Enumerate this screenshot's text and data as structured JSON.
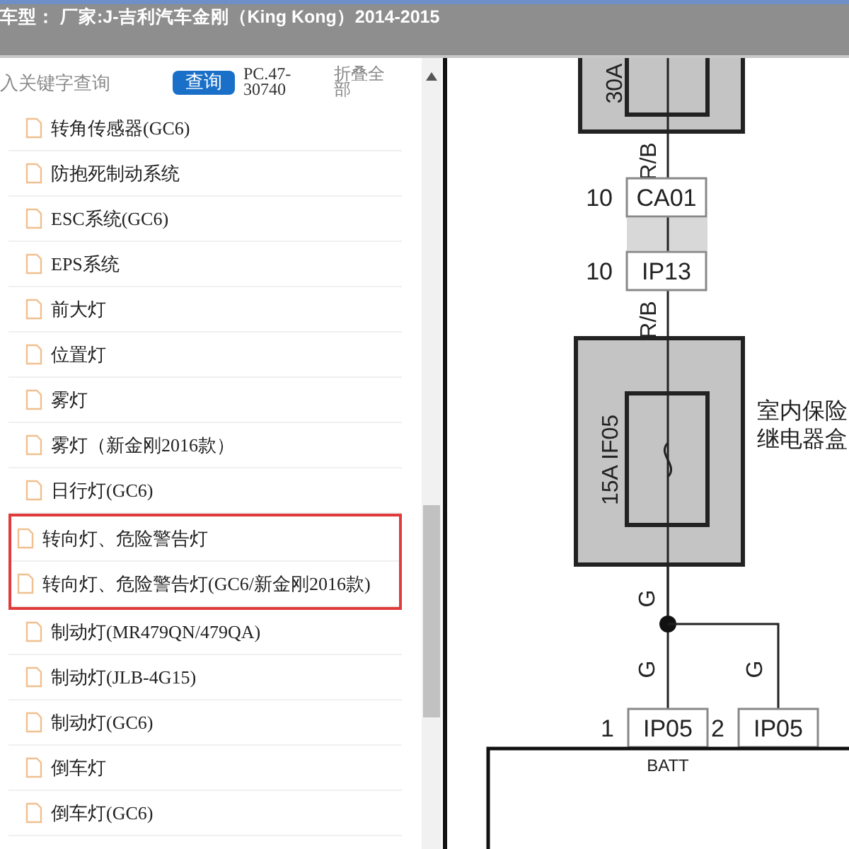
{
  "title_bar": {
    "title": "车型： 厂家:J-吉利汽车金刚（King Kong）2014-2015"
  },
  "toolbar": {
    "placeholder": "入关键字查询",
    "search_button": "查询",
    "code": "PC.47-30740",
    "collapse": "折叠全部"
  },
  "tree": {
    "items": [
      {
        "label": "转角传感器(GC6)",
        "selected": false
      },
      {
        "label": "防抱死制动系统",
        "selected": false
      },
      {
        "label": "ESC系统(GC6)",
        "selected": false
      },
      {
        "label": "EPS系统",
        "selected": false
      },
      {
        "label": "前大灯",
        "selected": false
      },
      {
        "label": "位置灯",
        "selected": false
      },
      {
        "label": "雾灯",
        "selected": false
      },
      {
        "label": "雾灯（新金刚2016款）",
        "selected": false
      },
      {
        "label": "日行灯(GC6)",
        "selected": false
      },
      {
        "label": "转向灯、危险警告灯",
        "selected": true
      },
      {
        "label": "转向灯、危险警告灯(GC6/新金刚2016款)",
        "selected": true
      },
      {
        "label": "制动灯(MR479QN/479QA)",
        "selected": false
      },
      {
        "label": "制动灯(JLB-4G15)",
        "selected": false
      },
      {
        "label": "制动灯(GC6)",
        "selected": false
      },
      {
        "label": "倒车灯",
        "selected": false
      },
      {
        "label": "倒车灯(GC6)",
        "selected": false
      }
    ]
  },
  "diagram": {
    "top_fuse": "30A",
    "wire_labels": [
      "R/B",
      "R/B",
      "G",
      "G",
      "G"
    ],
    "connectors": [
      {
        "pin": "10",
        "name": "CA01"
      },
      {
        "pin": "10",
        "name": "IP13"
      }
    ],
    "fuse": "15A IF05",
    "box_label": [
      "室内保险",
      "继电器盒"
    ],
    "bottom_connectors": [
      {
        "pin": "1",
        "name": "IP05"
      },
      {
        "pin": "2",
        "name": "IP05"
      }
    ],
    "bottom_label": "BATT"
  }
}
